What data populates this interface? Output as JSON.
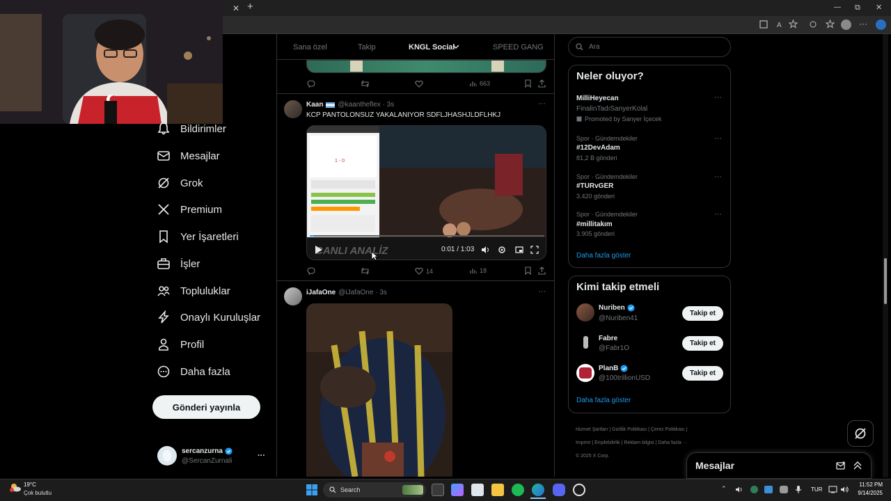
{
  "browser": {
    "close_tab_glyph": "✕",
    "new_tab_glyph": "+",
    "win_min": "—",
    "win_max": "⧉",
    "win_close": "✕"
  },
  "nav": {
    "items": [
      {
        "label": "Bildirimler",
        "icon": "bell-icon"
      },
      {
        "label": "Mesajlar",
        "icon": "mail-icon"
      },
      {
        "label": "Grok",
        "icon": "grok-icon"
      },
      {
        "label": "Premium",
        "icon": "x-logo-icon"
      },
      {
        "label": "Yer İşaretleri",
        "icon": "bookmark-icon"
      },
      {
        "label": "İşler",
        "icon": "briefcase-icon"
      },
      {
        "label": "Topluluklar",
        "icon": "people-icon"
      },
      {
        "label": "Onaylı Kuruluşlar",
        "icon": "lightning-icon"
      },
      {
        "label": "Profil",
        "icon": "person-icon"
      },
      {
        "label": "Daha fazla",
        "icon": "more-circle-icon"
      }
    ],
    "post_button": "Gönderi yayınla",
    "account": {
      "name": "sercanzurna",
      "handle": "@SercanZurnali",
      "more": "···"
    }
  },
  "timeline": {
    "tabs": [
      "Sana özel",
      "Takip",
      "KNGL Social",
      "SPEED GANG"
    ],
    "tweet0": {
      "views": "663"
    },
    "tweet1": {
      "name": "Kaan",
      "handle": "@kaantheflex · 3s",
      "text": "KCP PANTOLONSUZ YAKALANIYOR SDFLJHASHJLDFLHKJ",
      "video_time": "0:01 / 1:03",
      "video_overlay": "CANLI ANALİZ",
      "likes": "14",
      "views": "18",
      "more": "···"
    },
    "tweet2": {
      "name": "iJafaOne",
      "handle": "@iJafaOne · 3s",
      "more": "···"
    }
  },
  "sidebar": {
    "search_placeholder": "Ara",
    "trends_title": "Neler oluyor?",
    "promoted": {
      "name": "MilliHeyecan",
      "sub": "FinalinTadıSanyerKolal",
      "promo": "Promoted by Sanyer İçecek"
    },
    "trends": [
      {
        "meta": "Spor · Gündemdekiler",
        "name": "#12DevAdam",
        "count": "81,2 B gönderi"
      },
      {
        "meta": "Spor · Gündemdekiler",
        "name": "#TURvGER",
        "count": "3.420 gönderi"
      },
      {
        "meta": "Spor · Gündemdekiler",
        "name": "#millitakım",
        "count": "3.905 gönderi"
      }
    ],
    "show_more": "Daha fazla göster",
    "follow_title": "Kimi takip etmeli",
    "follow": [
      {
        "name": "Nuriben",
        "handle": "@Nuriben41",
        "verified": true
      },
      {
        "name": "Fabre",
        "handle": "@Fabr1O",
        "verified": false
      },
      {
        "name": "PlanB",
        "handle": "@100trillionUSD",
        "verified": true
      }
    ],
    "follow_button": "Takip et",
    "follow_show_more": "Daha fazla göster",
    "footer": [
      "Hizmet Şartları",
      "Gizlilik Politikası",
      "Çerez Politikası",
      "Imprint",
      "Erişilebilirlik",
      "Reklam bilgisi",
      "Daha fazla ···",
      "© 2025 X Corp."
    ]
  },
  "messages_bar": {
    "title": "Mesajlar"
  },
  "taskbar": {
    "weather_temp": "19°C",
    "weather_desc": "Çok bulutlu",
    "search": "Search",
    "lang": "TUR",
    "time": "11:52 PM",
    "date": "9/14/2025"
  },
  "colors": {
    "accent": "#1d9bf0",
    "bg": "#000000",
    "border": "#2f3336",
    "muted": "#71767b"
  }
}
